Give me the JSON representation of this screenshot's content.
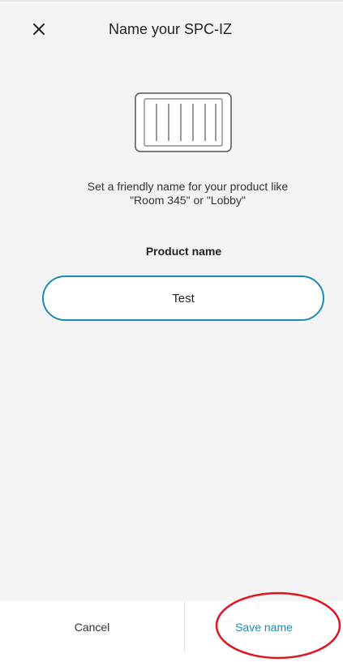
{
  "header": {
    "title": "Name your SPC-IZ",
    "close_icon": "close-icon"
  },
  "product": {
    "icon": "radiator-icon",
    "description": "Set a friendly name for your product like\n\"Room 345\" or \"Lobby\""
  },
  "form": {
    "label": "Product name",
    "value": "Test"
  },
  "footer": {
    "cancel_label": "Cancel",
    "save_label": "Save name"
  },
  "colors": {
    "accent": "#1b8bb6",
    "annotation": "#e0141e",
    "background": "#f4f4f4"
  }
}
